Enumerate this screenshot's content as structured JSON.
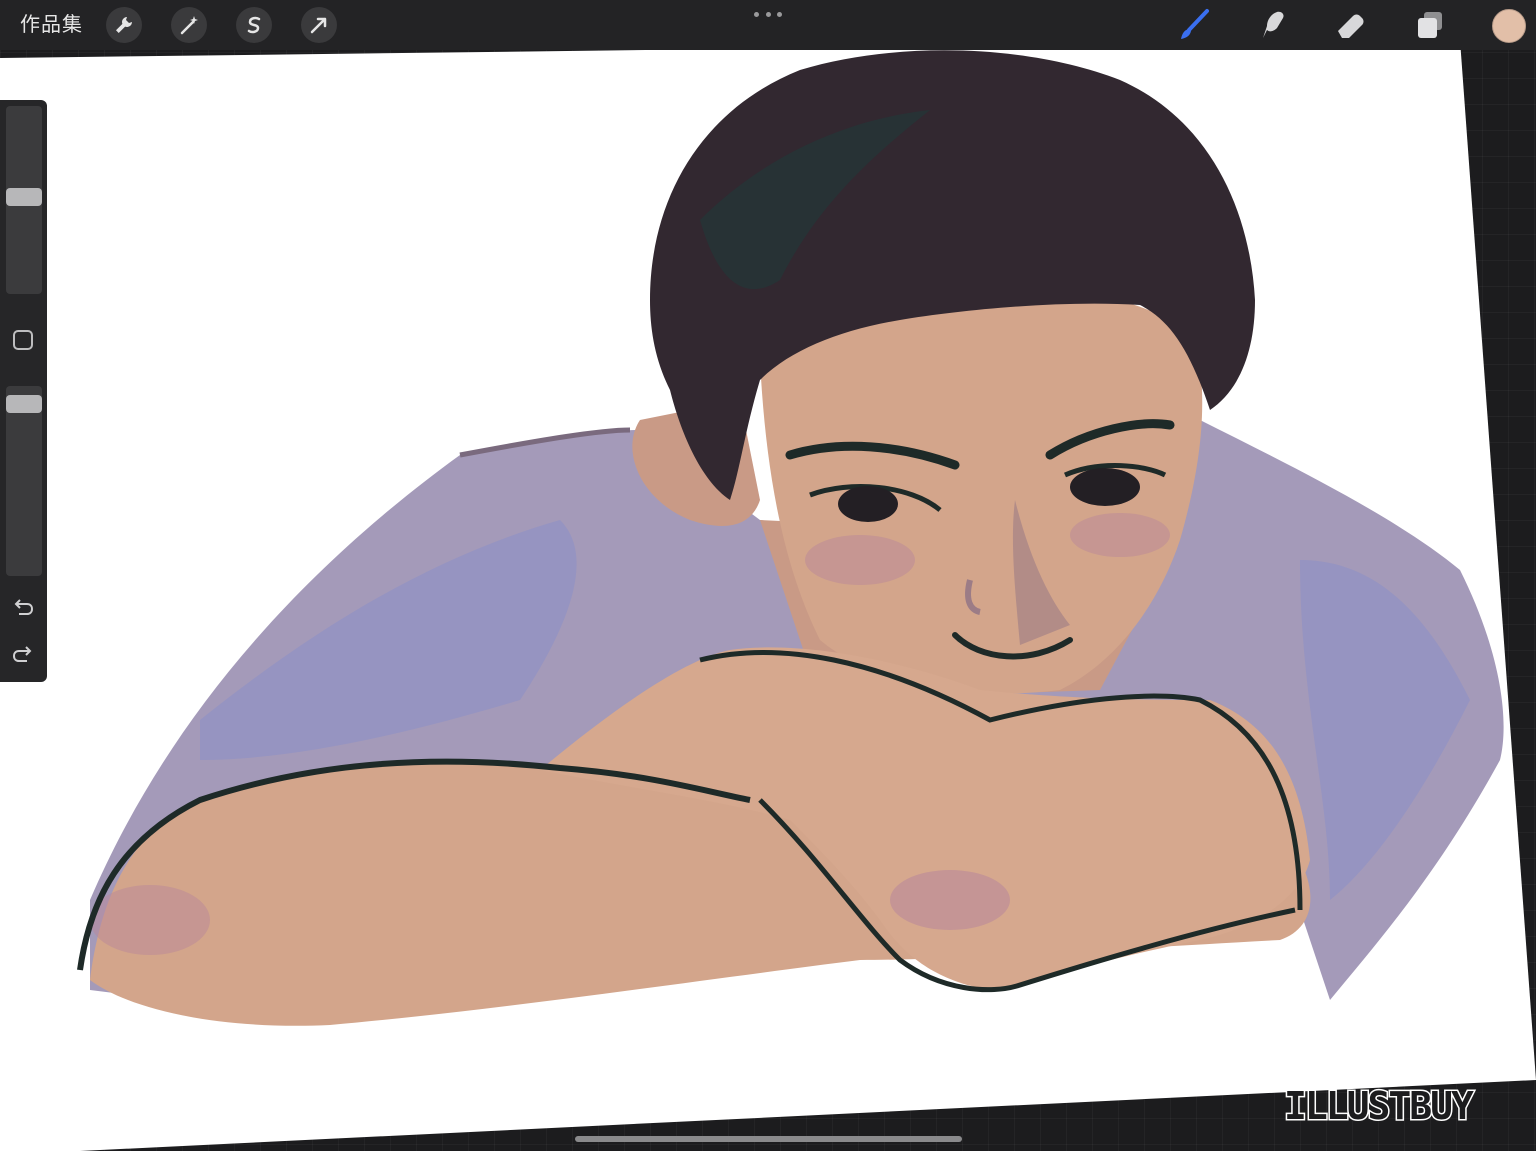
{
  "topbar": {
    "gallery_label": "作品集",
    "tools_left": [
      {
        "icon": "wrench-icon",
        "name": "actions"
      },
      {
        "icon": "magic-wand-icon",
        "name": "adjustments"
      },
      {
        "icon": "selection-s-icon",
        "name": "selection"
      },
      {
        "icon": "arrow-cursor-icon",
        "name": "transform"
      }
    ],
    "tools_right": [
      {
        "icon": "brush-icon",
        "name": "paint",
        "active": true
      },
      {
        "icon": "smudge-icon",
        "name": "smudge",
        "active": false
      },
      {
        "icon": "eraser-icon",
        "name": "erase",
        "active": false
      },
      {
        "icon": "layers-icon",
        "name": "layers",
        "active": false
      }
    ],
    "current_color": "#e2bfa8",
    "active_tool_color": "#3a6ff0"
  },
  "sidebar": {
    "brush_size_level": 0.52,
    "opacity_level": 0.05,
    "modify_icon": "square-modify-icon",
    "undo_icon": "undo-icon",
    "redo_icon": "redo-icon"
  },
  "artwork": {
    "palette": {
      "hair": "#322830",
      "hair_shadow": "#1f3a3a",
      "skin": "#d3a58b",
      "skin_shadow": "#b9889a",
      "shirt": "#a49ab9",
      "shirt_shadow": "#8a8fc8",
      "lines": "#1e2a28"
    }
  },
  "watermark": {
    "text": "ILLUSTBUY"
  }
}
